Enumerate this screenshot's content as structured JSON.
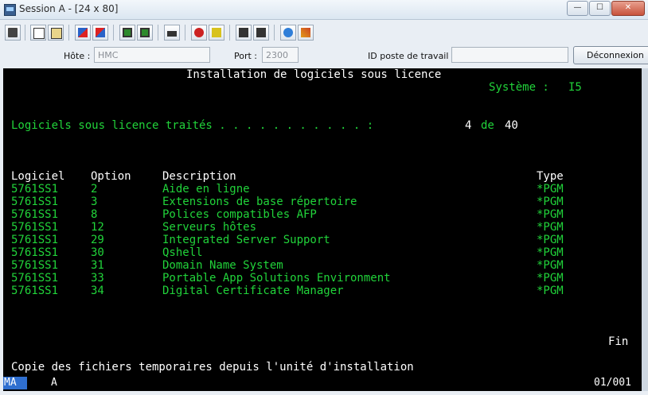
{
  "window": {
    "title": "Session A - [24 x 80]"
  },
  "window_buttons": {
    "minimize": "—",
    "maximize": "☐",
    "close": "✕"
  },
  "toolbar": {
    "icon_count": 16
  },
  "fields": {
    "host_label": "Hôte :",
    "host_value": "HMC",
    "port_label": "Port :",
    "port_value": "2300",
    "station_label": "ID poste de travail :",
    "station_value": "",
    "disconnect_label": "Déconnexion"
  },
  "screen": {
    "title": "Installation de logiciels sous licence",
    "system_label": "Système :",
    "system_value": "I5",
    "processed_label": "Logiciels sous licence traités . . . . . . . . . . . :",
    "processed_current": "4",
    "processed_de": "de",
    "processed_total": "40",
    "columns": {
      "logiciel": "Logiciel",
      "option": "Option",
      "description": "Description",
      "type": "Type"
    },
    "rows": [
      {
        "logiciel": "5761SS1",
        "option": "2",
        "description": "Aide en ligne",
        "type": "*PGM"
      },
      {
        "logiciel": "5761SS1",
        "option": "3",
        "description": "Extensions de base répertoire",
        "type": "*PGM"
      },
      {
        "logiciel": "5761SS1",
        "option": "8",
        "description": "Polices compatibles AFP",
        "type": "*PGM"
      },
      {
        "logiciel": "5761SS1",
        "option": "12",
        "description": "Serveurs hôtes",
        "type": "*PGM"
      },
      {
        "logiciel": "5761SS1",
        "option": "29",
        "description": "Integrated Server Support",
        "type": "*PGM"
      },
      {
        "logiciel": "5761SS1",
        "option": "30",
        "description": "Qshell",
        "type": "*PGM"
      },
      {
        "logiciel": "5761SS1",
        "option": "31",
        "description": "Domain Name System",
        "type": "*PGM"
      },
      {
        "logiciel": "5761SS1",
        "option": "33",
        "description": "Portable App Solutions Environment",
        "type": "*PGM"
      },
      {
        "logiciel": "5761SS1",
        "option": "34",
        "description": "Digital Certificate Manager",
        "type": "*PGM"
      }
    ],
    "end_label": "Fin",
    "message": "Copie des fichiers temporaires depuis l'unité d'installation"
  },
  "status": {
    "mode": "MA",
    "session": "A",
    "position": "01/001"
  },
  "colors": {
    "screen_bg": "#000000",
    "screen_green": "#21d33a",
    "screen_white": "#ffffff",
    "mode_badge": "#2f6fd0"
  }
}
